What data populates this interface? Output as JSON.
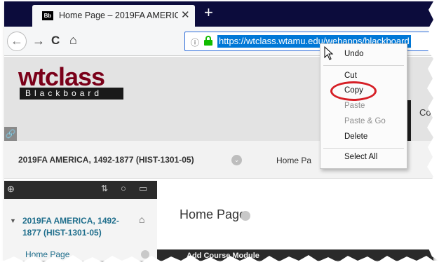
{
  "browser": {
    "tab_favicon": "Bb",
    "tab_title": "Home Page – 2019FA AMERICA",
    "tab_close": "✕",
    "new_tab": "+",
    "url": "https://wtclass.wtamu.edu/webapps/blackboard",
    "nav_icons": [
      "back-icon",
      "forward-icon",
      "reload-icon",
      "home-icon",
      "info-icon",
      "lock-icon"
    ],
    "secure_color": "#12bc00",
    "selection_color": "#0078d7"
  },
  "bb_header": {
    "logo_top": "wtclass",
    "logo_bottom": "Blackboard",
    "logo_color": "#7a0019",
    "right_partial": "Co"
  },
  "course_bar": {
    "course_title": "2019FA AMERICA, 1492-1877 (HIST-1301-05)",
    "breadcrumb": "Home Pa"
  },
  "sidebar": {
    "course_name": "2019FA AMERICA, 1492-1877 (HIST-1301-05)",
    "home_page_link": "Home Page"
  },
  "main": {
    "page_title": "Home Page",
    "module_bar_label": "Add Course Module"
  },
  "context_menu": {
    "items": [
      {
        "label": "Undo",
        "enabled": true
      },
      {
        "label": "Cut",
        "enabled": true
      },
      {
        "label": "Copy",
        "enabled": true,
        "highlighted": true
      },
      {
        "label": "Paste",
        "enabled": false
      },
      {
        "label": "Paste & Go",
        "enabled": false
      },
      {
        "label": "Delete",
        "enabled": true
      },
      {
        "label": "Select All",
        "enabled": true
      }
    ],
    "highlight_color": "#d61f26"
  }
}
